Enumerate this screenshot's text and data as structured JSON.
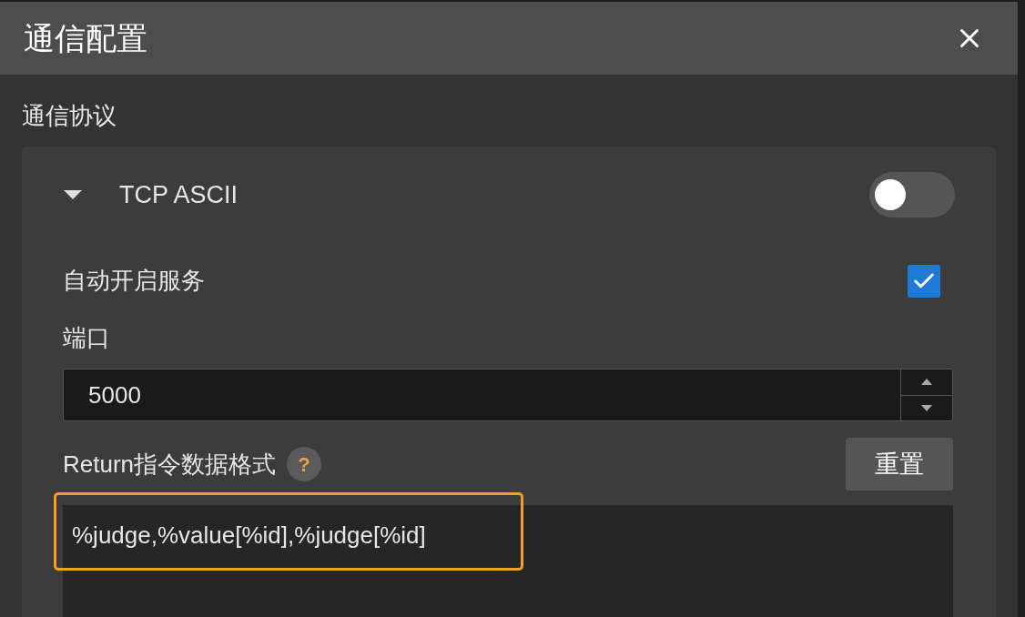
{
  "window": {
    "title": "通信配置"
  },
  "section_label": "通信协议",
  "protocol": {
    "name": "TCP ASCII",
    "expanded": true,
    "on": false
  },
  "auto_start": {
    "label": "自动开启服务",
    "checked": true
  },
  "port": {
    "label": "端口",
    "value": "5000"
  },
  "return_format": {
    "label": "Return指令数据格式",
    "help": "?",
    "reset_button": "重置",
    "value": "%judge,%value[%id],%judge[%id]",
    "highlighted": true
  }
}
